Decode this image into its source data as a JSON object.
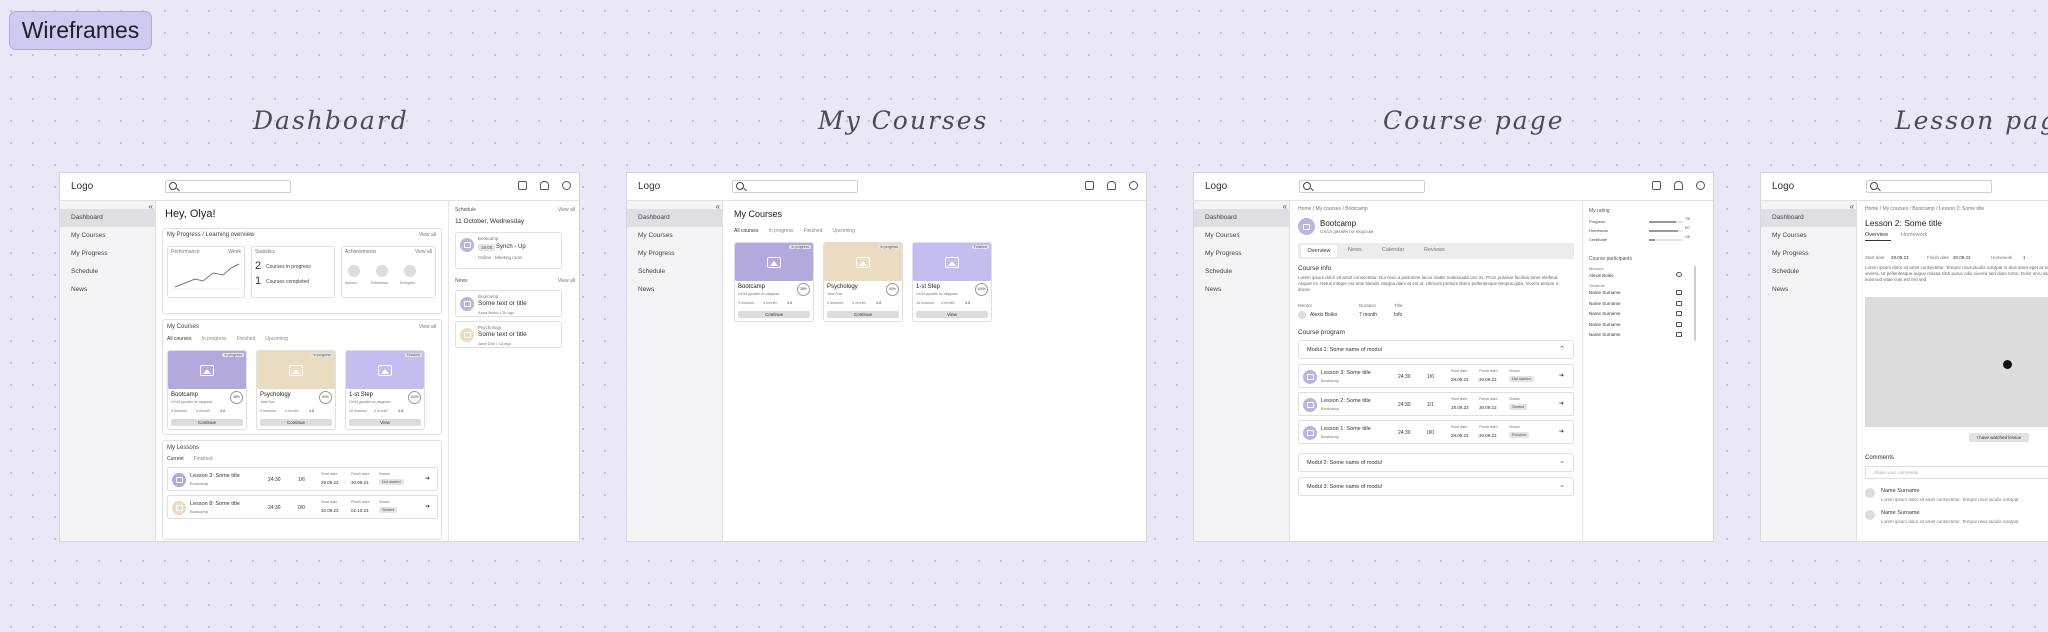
{
  "page_tag": "Wireframes",
  "frame_titles": [
    "Dashboard",
    "My Courses",
    "Course page",
    "Lesson page"
  ],
  "common": {
    "logo": "Logo",
    "nav": [
      "Dashboard",
      "My Courses",
      "My Progress",
      "Schedule",
      "News"
    ]
  },
  "dashboard": {
    "greeting": "Hey, Olya!",
    "progress_title": "My Progress / Learning overview",
    "view_all": "View all",
    "performance": "Performance",
    "week": "Week",
    "statistics": "Statistics",
    "stat1_num": "2",
    "stat1_label": "Courses in progress",
    "stat2_num": "1",
    "stat2_label": "Courses completed",
    "achievements": "Achievements",
    "ach_labels": [
      "Aphoris",
      "Extremista",
      "Energetic"
    ],
    "courses_title": "My Courses",
    "tabs": [
      "All courses",
      "In progress",
      "Finished",
      "Upcoming"
    ],
    "lessons_title": "My Lessons",
    "lesson_tabs": [
      "Current",
      "Finished"
    ],
    "lessons": [
      {
        "title": "Lesson 3: Some title",
        "course": "Bootcamp",
        "time": "24:30",
        "hw": "1/6",
        "start_label": "Start date",
        "start": "29.09.23",
        "finish_label": "Finish date",
        "finish": "30.09.23",
        "status_label": "Status",
        "status": "Not started"
      },
      {
        "title": "Lesson 8: Some title",
        "course": "Bootcamp",
        "time": "24:30",
        "hw": "0/0",
        "start_label": "Start date",
        "start": "30.09.23",
        "finish_label": "Finish date",
        "finish": "02.10.23",
        "status_label": "Status",
        "status": "Started"
      }
    ],
    "schedule_title": "Schedule",
    "schedule_date": "11 October, Wednesday",
    "schedule_course": "Bootcamp",
    "schedule_time": "19:00",
    "schedule_event": "Synch - Up",
    "schedule_meta": "Online · Meeting room",
    "news_title": "News",
    "news": [
      {
        "course": "Bootcamp",
        "title": "Some text or title",
        "meta": "Anna Boiko • 2h ago"
      },
      {
        "course": "Psychology",
        "title": "Some text or title",
        "meta": "Jane Doe • 1d ago"
      }
    ]
  },
  "courses": [
    {
      "name": "Bootcamp",
      "sub": "UX/UI дизайн по-людськи",
      "status": "In progress",
      "lessons": "9 lessons",
      "duration": "4 month",
      "rating": "4.6",
      "pct": "38%",
      "btn": "Continue",
      "color": "#b3a9dc"
    },
    {
      "name": "Psychology",
      "sub": "Jane Doe",
      "status": "In progress",
      "lessons": "9 lessons",
      "duration": "4 month",
      "rating": "4.8",
      "pct": "60%",
      "btn": "Continue",
      "color": "#e9dcc0"
    },
    {
      "name": "1-st Step",
      "sub": "UX/UI дизайн по-людськи",
      "status": "Finished",
      "lessons": "10 lessons",
      "duration": "4 month",
      "rating": "4.8",
      "pct": "100%",
      "btn": "View",
      "color": "#c3bdf0"
    }
  ],
  "mycourses": {
    "title": "My Courses"
  },
  "coursepage": {
    "breadcrumb": "Home / My courses / Bootcamp",
    "title": "Bootcamp",
    "subtitle": "UX/UI дизайн по-людськи",
    "tabs": [
      "Overview",
      "News",
      "Calendar",
      "Reviews"
    ],
    "info_title": "Course info",
    "info_text": "Lorem ipsum dolor sit amet consectetur. Dui risus a parturient lacus mattis malesuada orci mi. Proin pulvinar facilisis amet eleifend. Aliquet mi. Netus integer est ante blandit. Magna diam at est ut. Ultricies pretium libero pellentesque tempus gida. Viverra tempor a donec.",
    "mentor_label": "Mentor",
    "mentor": "Alexis Boiko",
    "duration_label": "Duration",
    "duration": "7 month",
    "title_label": "Title",
    "title_val": "Info",
    "program_title": "Course program",
    "module1": "Modul 1: Some name of modul",
    "module2": "Modul 2: Some name of modul",
    "module3": "Modul 3: Some name of modul",
    "lessons": [
      {
        "title": "Lesson 3: Some title",
        "course": "Bootcamp",
        "time": "24:30",
        "hw": "1/6",
        "start": "28.09.23",
        "finish": "30.09.23",
        "status": "Not started"
      },
      {
        "title": "Lesson 2: Some title",
        "course": "Bootcamp",
        "time": "24:30",
        "hw": "1/1",
        "start": "28.09.23",
        "finish": "30.09.23",
        "status": "Started"
      },
      {
        "title": "Lesson 1: Some title",
        "course": "Bootcamp",
        "time": "24:30",
        "hw": "0/0",
        "start": "28.09.23",
        "finish": "30.09.23",
        "status": "Finished"
      }
    ],
    "start_label": "Start date",
    "finish_label": "Finish date",
    "status_label": "Status",
    "rating_title": "My rating",
    "rating_rows": [
      {
        "label": "Progress",
        "val": "7/9",
        "fill": 0.78
      },
      {
        "label": "Homework",
        "val": "6/7",
        "fill": 0.86
      },
      {
        "label": "Certificate",
        "val": "1/6",
        "fill": 0.17
      }
    ],
    "participants_title": "Course participants",
    "mentors_label": "Mentors",
    "mentor_name": "Alexis Boiko",
    "students_label": "Students",
    "students": [
      "Name Surname",
      "Name Surname",
      "Name Surname",
      "Name Surname",
      "Name Surname"
    ]
  },
  "lessonpage": {
    "breadcrumb": "Home / My courses / Bootcamp / Lesson 2: Some title",
    "title": "Lesson 2: Some title",
    "tabs": [
      "Overview",
      "Homework"
    ],
    "start_label": "Start date",
    "start": "28.09.23",
    "finish_label": "Finish date",
    "finish": "30.09.23",
    "hw_label": "Homework",
    "hw": "1",
    "text": "Lorem ipsum dolor sit amet consectetur. Tempor risus iaculis volutpat in duis amet eget at sed viverra. Ut pellentesque augue massa nibh purus odio viverra sed diam tortor. Dolor arcu vitae euismod vitae cras est nisi sed",
    "watched_btn": "I have watched lesson",
    "comments_title": "Comments",
    "comment_placeholder": "Share your comments",
    "comments": [
      {
        "name": "Name Surname",
        "text": "Lorem ipsum dolor sit amet consectetur. Tempor risus iaculis volutpat"
      },
      {
        "name": "Name Surname",
        "text": "Lorem ipsum dolor sit amet consectetur. Tempor risus iaculis volutpat"
      }
    ]
  }
}
